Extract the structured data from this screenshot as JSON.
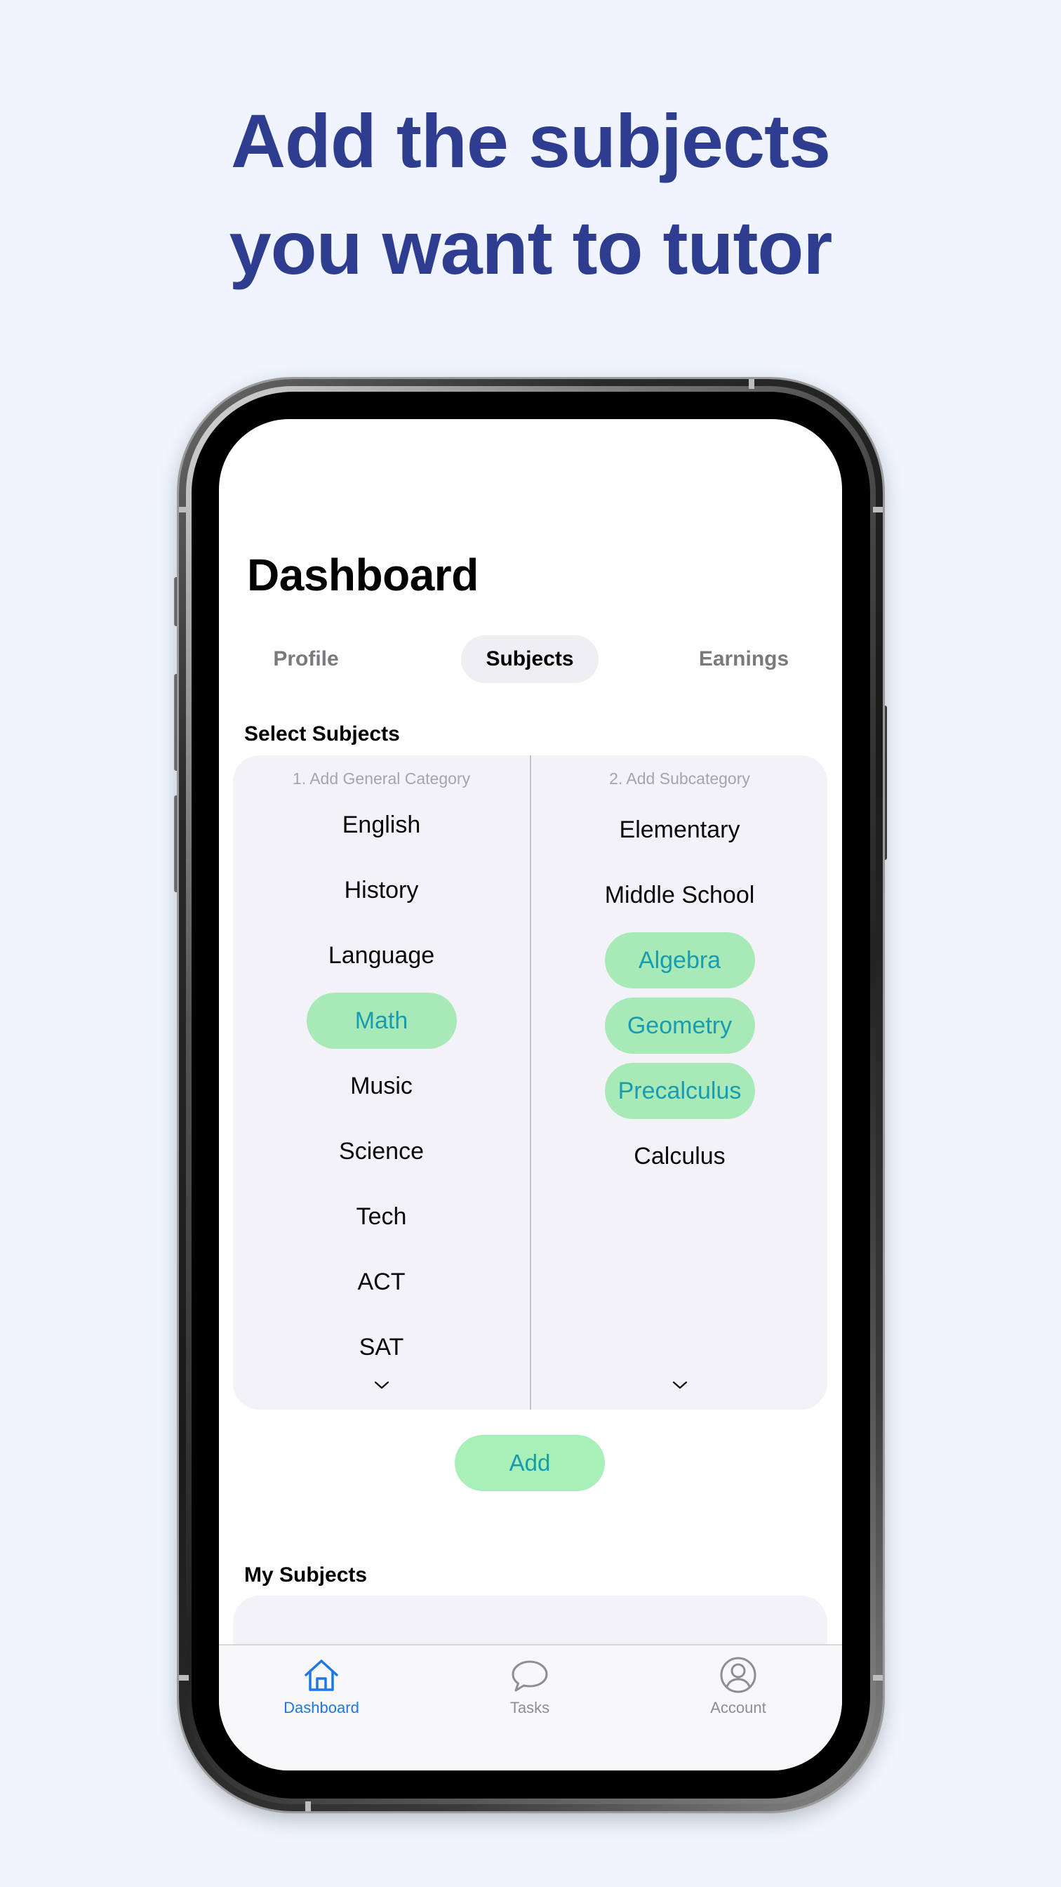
{
  "headline": {
    "line1": "Add the subjects",
    "line2": "you want to tutor"
  },
  "dashboard": {
    "title": "Dashboard",
    "tabs": [
      {
        "label": "Profile",
        "active": false
      },
      {
        "label": "Subjects",
        "active": true
      },
      {
        "label": "Earnings",
        "active": false
      }
    ],
    "select_label": "Select Subjects",
    "general": {
      "header": "1. Add General Category",
      "items": [
        "English",
        "History",
        "Language",
        "Math",
        "Music",
        "Science",
        "Tech",
        "ACT",
        "SAT"
      ],
      "selected": [
        "Math"
      ]
    },
    "sub": {
      "header": "2. Add Subcategory",
      "items": [
        "Elementary",
        "Middle School",
        "Algebra",
        "Geometry",
        "Precalculus",
        "Calculus"
      ],
      "selected": [
        "Algebra",
        "Geometry",
        "Precalculus"
      ]
    },
    "add_label": "Add",
    "my_subjects_label": "My Subjects"
  },
  "tabbar": {
    "items": [
      {
        "label": "Dashboard",
        "icon": "home-icon",
        "active": true
      },
      {
        "label": "Tasks",
        "icon": "chat-bubble-icon",
        "active": false
      },
      {
        "label": "Account",
        "icon": "person-circle-icon",
        "active": false
      }
    ]
  },
  "colors": {
    "headline": "#2e3d8f",
    "background": "#eff4fe",
    "pill": "#a8eab7",
    "pill_text": "#1a9bb0",
    "active_tab": "#1f77e4"
  }
}
